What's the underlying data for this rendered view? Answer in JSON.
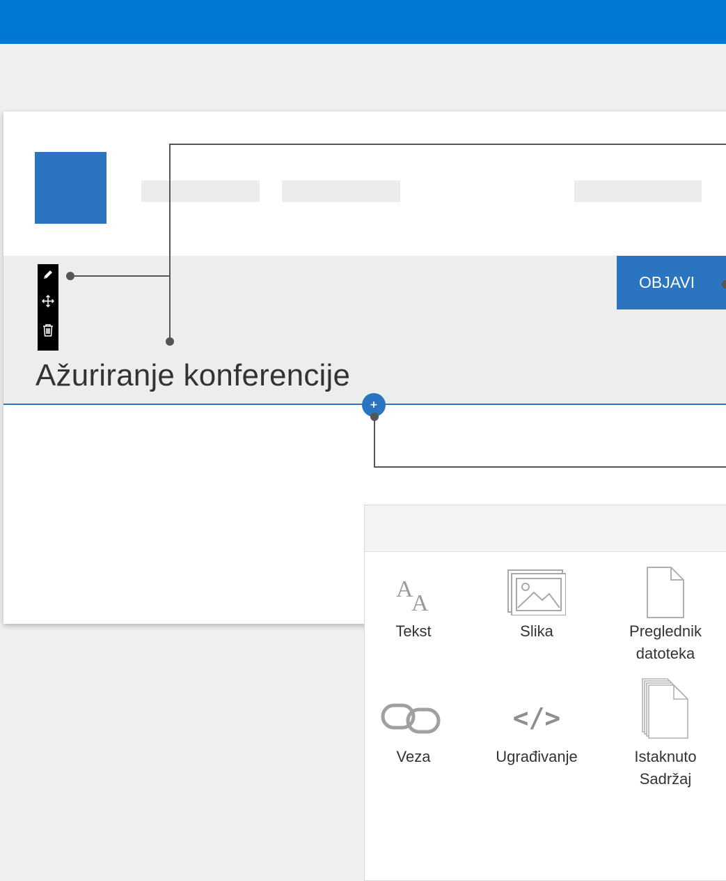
{
  "page": {
    "title": "Ažuriranje konferencije",
    "publish_label": "OBJAVI",
    "add_symbol": "+"
  },
  "toolbar": {
    "icons": [
      "pencil-icon",
      "move-icon",
      "trash-icon"
    ]
  },
  "toolbox": {
    "items": [
      {
        "icon": "text-icon",
        "glyph": "A",
        "label_line1": "Tekst",
        "label_line2": ""
      },
      {
        "icon": "image-icon",
        "label_line1": "Slika",
        "label_line2": ""
      },
      {
        "icon": "file-icon",
        "label_line1": "Preglednik",
        "label_line2": "datoteka"
      },
      {
        "icon": "link-icon",
        "label_line1": "Veza",
        "label_line2": ""
      },
      {
        "icon": "embed-icon",
        "glyph": "</>",
        "label_line1": "Ugrađivanje",
        "label_line2": ""
      },
      {
        "icon": "stacked-files-icon",
        "label_line1": "Istaknuto",
        "label_line2": "Sadržaj"
      }
    ]
  },
  "colors": {
    "topbar": "#0078d4",
    "accent": "#2b74c0",
    "band": "#eceded",
    "background": "#f0f0f0"
  }
}
